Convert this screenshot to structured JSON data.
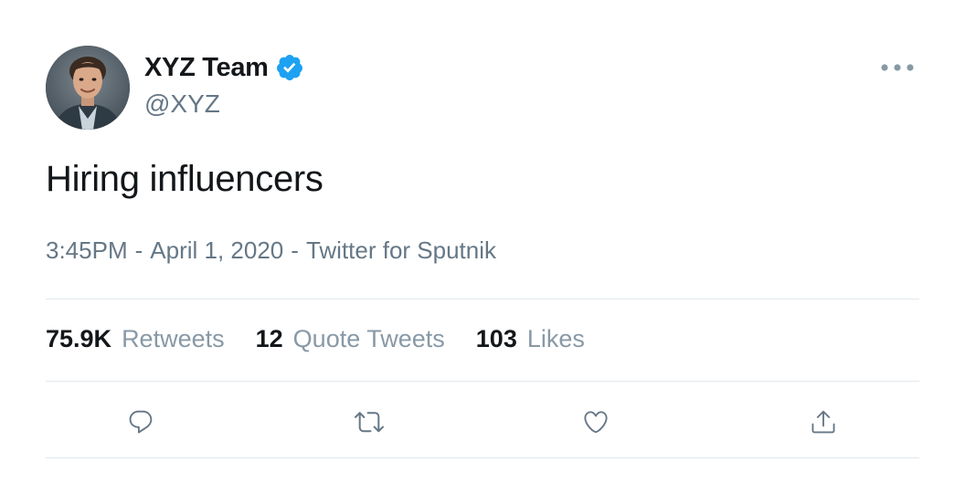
{
  "author": {
    "display_name": "XYZ Team",
    "handle": "@XYZ",
    "verified": true
  },
  "tweet": {
    "text": "Hiring influencers",
    "time": "3:45PM",
    "date": "April 1, 2020",
    "source": "Twitter for Sputnik",
    "separator": "-"
  },
  "stats": {
    "retweets_count": "75.9K",
    "retweets_label": "Retweets",
    "quote_count": "12",
    "quote_label": "Quote Tweets",
    "likes_count": "103",
    "likes_label": "Likes"
  },
  "icons": {
    "more": "more-horizontal-icon",
    "verified": "verified-badge-icon",
    "reply": "reply-icon",
    "retweet": "retweet-icon",
    "like": "heart-icon",
    "share": "share-icon"
  },
  "colors": {
    "text_primary": "#14171a",
    "text_secondary": "#657786",
    "verified_blue": "#1da1f2",
    "divider": "#e1e8ed",
    "icon_gray": "#657786"
  }
}
